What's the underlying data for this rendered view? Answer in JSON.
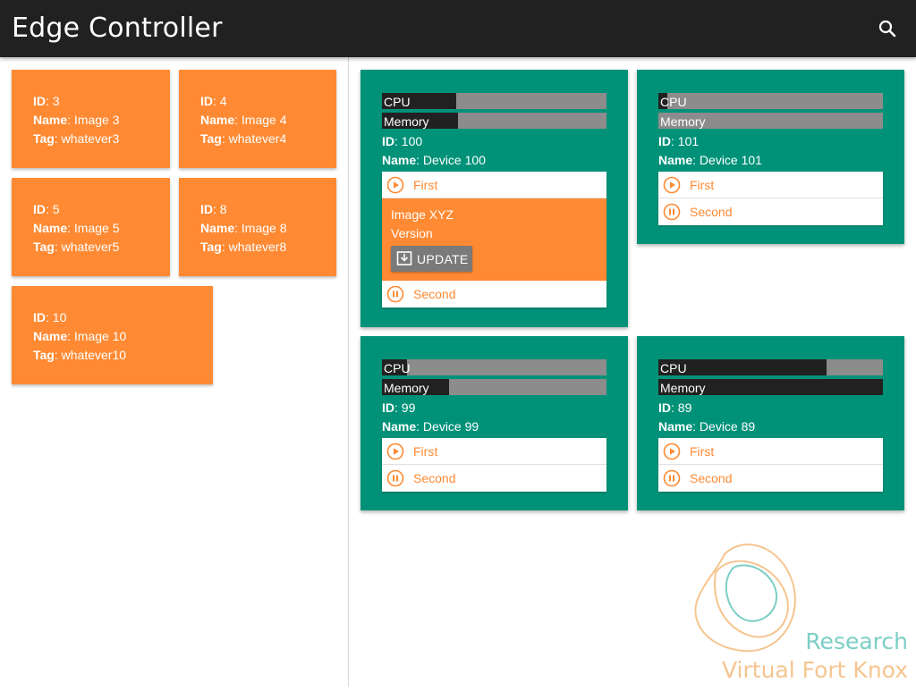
{
  "app": {
    "title": "Edge Controller",
    "search_icon": "search-icon"
  },
  "labels": {
    "id": "ID",
    "name": "Name",
    "tag": "Tag",
    "cpu": "CPU",
    "memory": "Memory"
  },
  "images": [
    {
      "id": "3",
      "name": "Image 3",
      "tag": "whatever3"
    },
    {
      "id": "4",
      "name": "Image 4",
      "tag": "whatever4"
    },
    {
      "id": "5",
      "name": "Image 5",
      "tag": "whatever5"
    },
    {
      "id": "8",
      "name": "Image 8",
      "tag": "whatever8"
    },
    {
      "id": "10",
      "name": "Image 10",
      "tag": "whatever10"
    }
  ],
  "devices": [
    {
      "id": "100",
      "name": "Device 100",
      "cpu_usage": 0.33,
      "memory_usage": 0.34,
      "processes": [
        {
          "name": "First",
          "state": "play"
        },
        {
          "name": "Second",
          "state": "pause"
        }
      ],
      "expanded": {
        "image": "Image XYZ",
        "version": "Version",
        "update_label": "UPDATE"
      }
    },
    {
      "id": "101",
      "name": "Device 101",
      "cpu_usage": 0.04,
      "memory_usage": 0.0,
      "processes": [
        {
          "name": "First",
          "state": "play"
        },
        {
          "name": "Second",
          "state": "pause"
        }
      ]
    },
    {
      "id": "99",
      "name": "Device 99",
      "cpu_usage": 0.11,
      "memory_usage": 0.3,
      "processes": [
        {
          "name": "First",
          "state": "play"
        },
        {
          "name": "Second",
          "state": "pause"
        }
      ]
    },
    {
      "id": "89",
      "name": "Device 89",
      "cpu_usage": 0.75,
      "memory_usage": 1.0,
      "processes": [
        {
          "name": "First",
          "state": "play"
        },
        {
          "name": "Second",
          "state": "pause"
        }
      ]
    }
  ],
  "logo": {
    "line1": "Research",
    "line2": "Virtual Fort Knox"
  },
  "colors": {
    "appbar": "#212121",
    "image_card": "#ff8a33",
    "device_card": "#009279",
    "meter_track": "#8c8c8c",
    "meter_fill": "#212121",
    "accent_orange": "#ff8a33"
  }
}
